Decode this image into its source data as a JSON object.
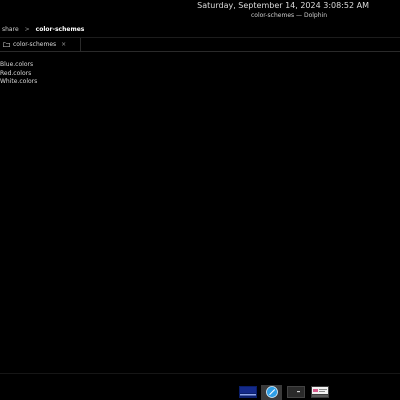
{
  "topbar": {
    "clock": "Saturday, September 14, 2024 3:08:52 AM",
    "window_title": "color-schemes — Dolphin"
  },
  "breadcrumb": {
    "items": [
      "share",
      "color-schemes"
    ],
    "separator": ">"
  },
  "tabs": [
    {
      "label": "color-schemes",
      "close": "×"
    }
  ],
  "files": [
    "Blue.colors",
    "Red.colors",
    "White.colors"
  ],
  "taskbar": {
    "items": [
      {
        "icon": "window-thumbnail-icon"
      },
      {
        "icon": "browser-icon",
        "active": true
      },
      {
        "icon": "terminal-icon"
      },
      {
        "icon": "window-thumbnail-icon-2"
      }
    ]
  },
  "colors": {
    "background": "#000000",
    "text": "#e6e6e6",
    "accent_blue": "#2f6fd6"
  }
}
